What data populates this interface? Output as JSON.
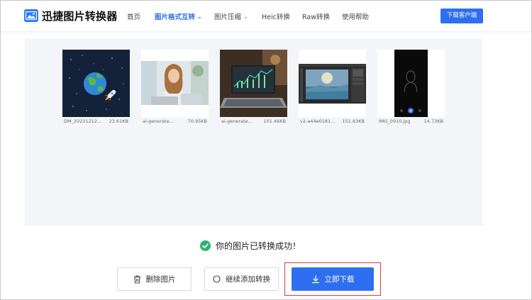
{
  "app": {
    "brand": "迅捷图片转换器"
  },
  "nav": [
    {
      "label": "首页",
      "active": false,
      "dropdown": false
    },
    {
      "label": "图片格式互转",
      "active": true,
      "dropdown": true
    },
    {
      "label": "图片压缩",
      "active": false,
      "dropdown": true
    },
    {
      "label": "Heic转换",
      "active": false,
      "dropdown": false
    },
    {
      "label": "Raw转换",
      "active": false,
      "dropdown": false
    },
    {
      "label": "使用帮助",
      "active": false,
      "dropdown": false
    }
  ],
  "header": {
    "download_client": "下载客户端"
  },
  "files": [
    {
      "name": "DM_20231212...",
      "size": "23.61KB",
      "icon": "space-earth-rocket-image"
    },
    {
      "name": "ai-generate...",
      "size": "70.95KB",
      "icon": "woman-laptop-photo"
    },
    {
      "name": "ai-generate...",
      "size": "101.46KB",
      "icon": "laptop-chart-photo"
    },
    {
      "name": "v2-a44e0181...",
      "size": "151.63KB",
      "icon": "photo-editor-screenshot"
    },
    {
      "name": "IMG_0910.jpg",
      "size": "14.73KB",
      "icon": "phone-camera-screenshot"
    }
  ],
  "status": {
    "message": "你的图片已转换成功！",
    "color": "#27b36e"
  },
  "actions": {
    "delete_label": "删除图片",
    "add_label": "继续添加转换",
    "download_label": "立即下载"
  },
  "colors": {
    "accent": "#2d6ff0",
    "highlight": "#e23b3b"
  }
}
